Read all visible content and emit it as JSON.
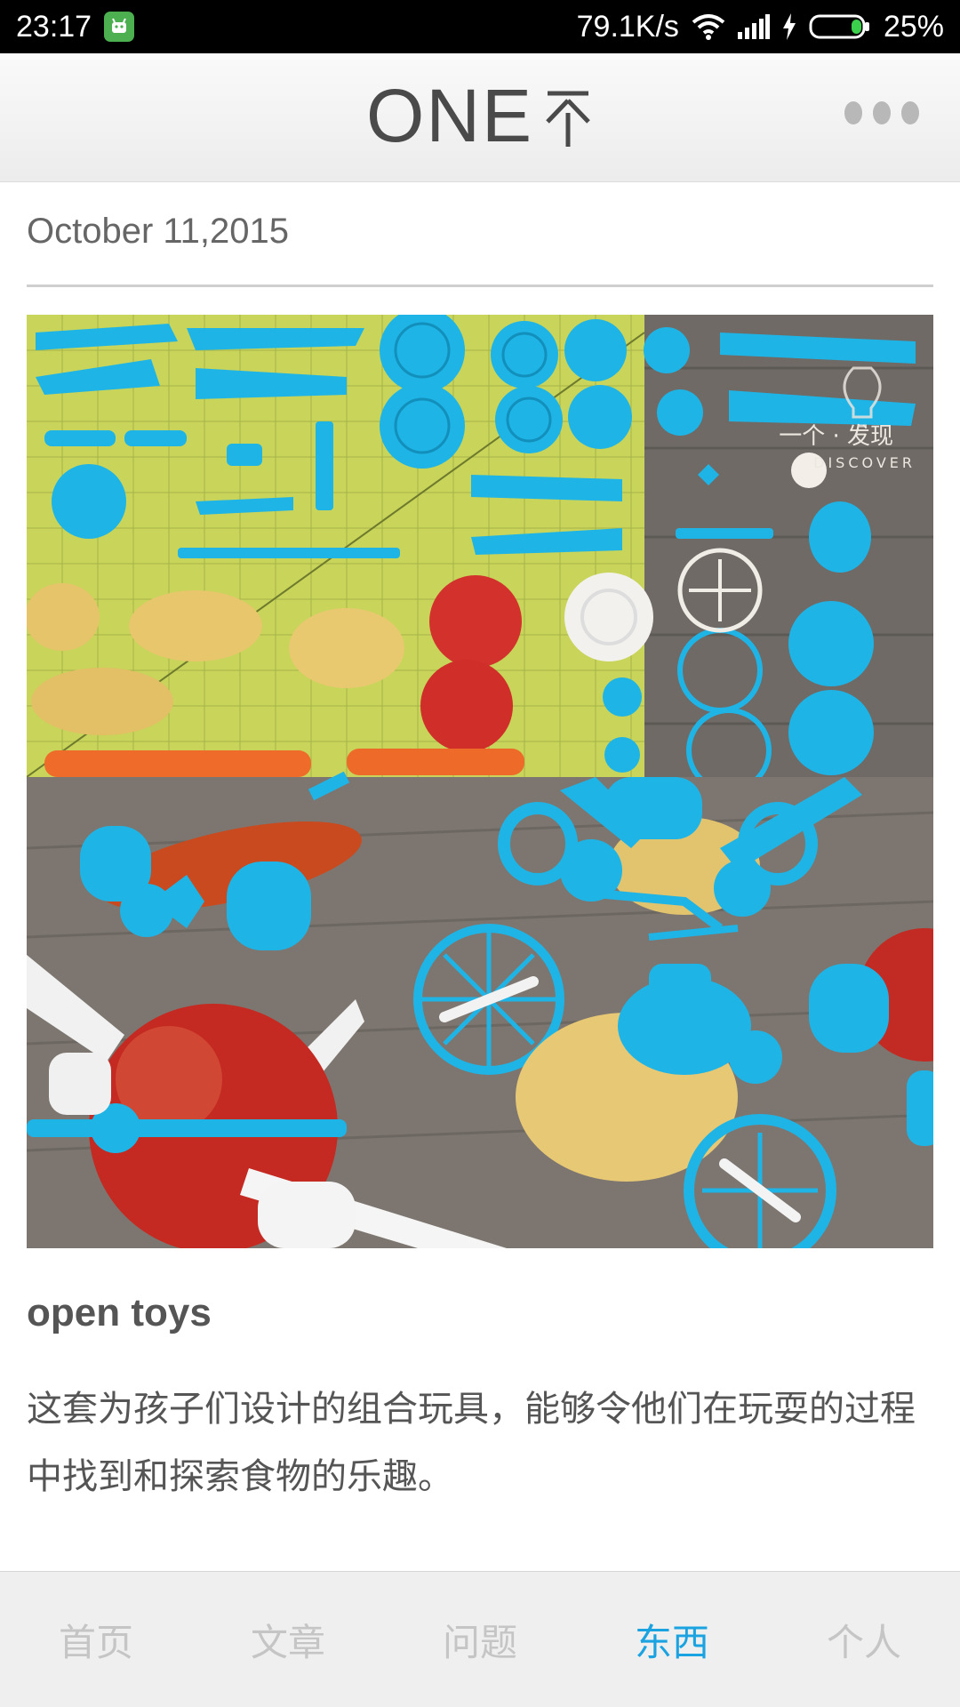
{
  "status_bar": {
    "time": "23:17",
    "network_speed": "79.1K/s",
    "battery_percent": "25%",
    "icons": [
      "android-app-icon",
      "wifi-icon",
      "signal-icon",
      "charging-icon",
      "battery-icon"
    ]
  },
  "header": {
    "logo_text": "ONE",
    "logo_cn": "一个",
    "menu_icon": "more-dots-icon"
  },
  "article": {
    "date": "October 11,2015",
    "title": "open toys",
    "description": "这套为孩子们设计的组合玩具，能够令他们在玩耍的过程中找到和探索食物的乐趣。",
    "image_watermark": {
      "cn": "一个 · 发现",
      "en": "DISCOVER"
    }
  },
  "bottom_nav": {
    "items": [
      {
        "label": "首页",
        "active": false
      },
      {
        "label": "文章",
        "active": false
      },
      {
        "label": "问题",
        "active": false
      },
      {
        "label": "东西",
        "active": true
      },
      {
        "label": "个人",
        "active": false
      }
    ]
  },
  "colors": {
    "accent": "#1aa3e0",
    "toy_blue": "#1fb4e6",
    "inactive_nav": "#c5c5c5"
  }
}
